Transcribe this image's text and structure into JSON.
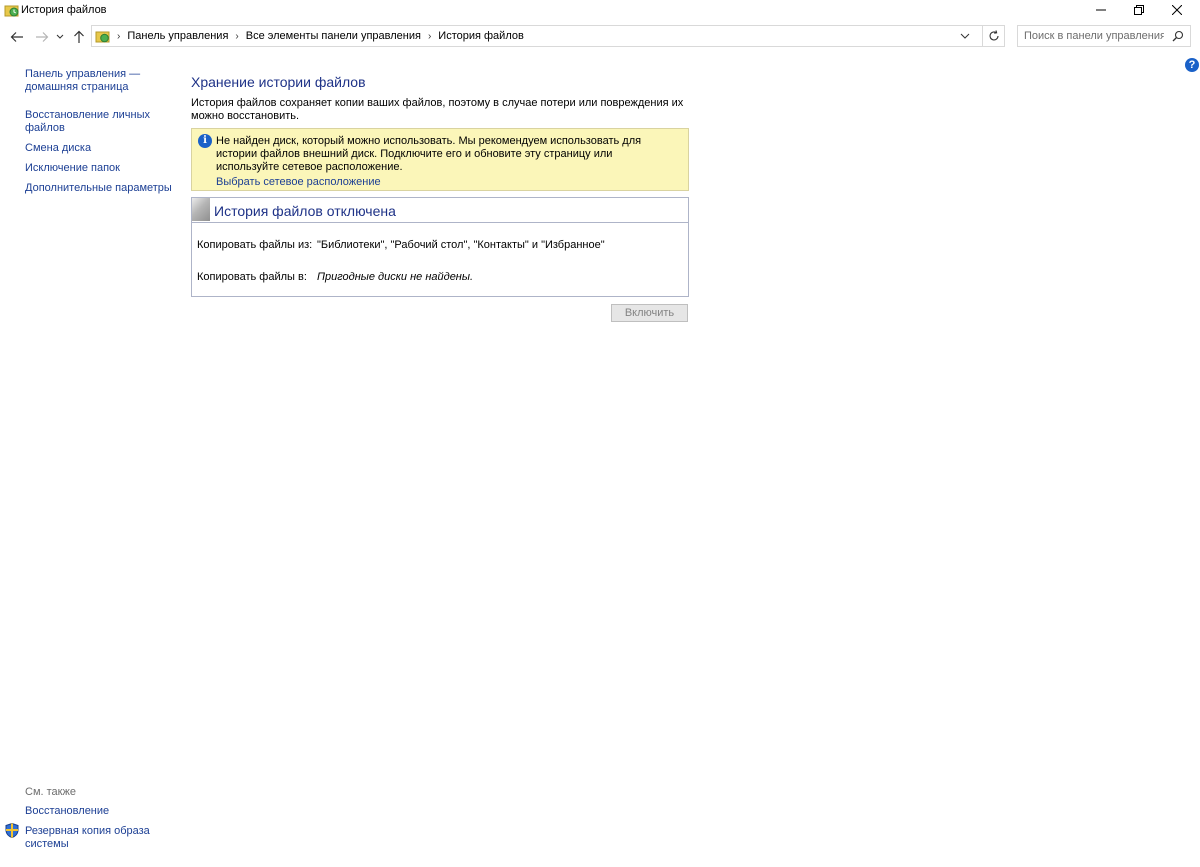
{
  "window": {
    "title": "История файлов"
  },
  "address": {
    "crumbs": [
      "Панель управления",
      "Все элементы панели управления",
      "История файлов"
    ]
  },
  "search": {
    "placeholder": "Поиск в панели управления"
  },
  "sidebar": {
    "items": [
      {
        "label": "Панель управления —\nдомашняя страница"
      },
      {
        "label": "Восстановление личных\nфайлов"
      },
      {
        "label": "Смена диска"
      },
      {
        "label": "Исключение папок"
      },
      {
        "label": "Дополнительные параметры"
      }
    ],
    "see_also_heading": "См. также",
    "see_also": [
      {
        "label": "Восстановление"
      },
      {
        "label": "Резервная копия образа\nсистемы"
      }
    ]
  },
  "main": {
    "title": "Хранение истории файлов",
    "description": "История файлов сохраняет копии ваших файлов, поэтому в случае потери или повреждения их можно восстановить.",
    "info": {
      "message": "Не найден диск, который можно использовать. Мы рекомендуем использовать для истории файлов внешний диск. Подключите его и обновите эту страницу или используйте сетевое расположение.",
      "link": "Выбрать сетевое расположение"
    },
    "status": {
      "title": "История файлов отключена",
      "copy_from_label": "Копировать файлы из:",
      "copy_from_value": "\"Библиотеки\", \"Рабочий стол\", \"Контакты\" и \"Избранное\"",
      "copy_to_label": "Копировать файлы в:",
      "copy_to_value": "Пригодные диски не найдены."
    },
    "enable_button": "Включить"
  },
  "colors": {
    "link": "#1c3f94",
    "heading": "#1e3287",
    "info_background": "#fbf6b9",
    "help_blue": "#1a61c8"
  }
}
